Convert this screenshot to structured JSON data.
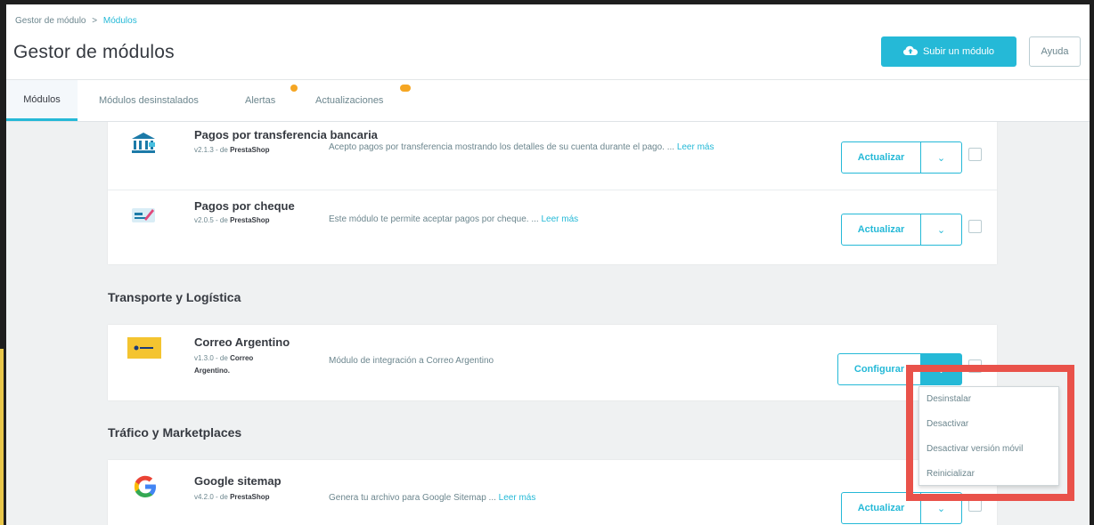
{
  "breadcrumb": {
    "parent": "Gestor de módulo",
    "separator": ">",
    "current": "Módulos"
  },
  "header": {
    "title": "Gestor de módulos",
    "upload_label": "Subir un módulo",
    "help_label": "Ayuda"
  },
  "tabs": [
    {
      "label": "Módulos",
      "active": true
    },
    {
      "label": "Módulos desinstalados"
    },
    {
      "label": "Alertas",
      "badge": true
    },
    {
      "label": "Actualizaciones",
      "badge": true
    }
  ],
  "payments": {
    "modules": [
      {
        "name": "Pagos por transferencia bancaria",
        "version": "v2.1.3",
        "by_prefix": "- de",
        "author": "PrestaShop",
        "description": "Acepto pagos por transferencia mostrando los detalles de su cuenta durante el pago. ...",
        "read_more": "Leer más",
        "action": "Actualizar",
        "icon": "bank-icon"
      },
      {
        "name": "Pagos por cheque",
        "version": "v2.0.5",
        "by_prefix": "- de",
        "author": "PrestaShop",
        "description": "Este módulo te permite aceptar pagos por cheque. ...",
        "read_more": "Leer más",
        "action": "Actualizar",
        "icon": "cheque-icon"
      }
    ]
  },
  "shipping": {
    "title": "Transporte y Logística",
    "module": {
      "name": "Correo Argentino",
      "version": "v1.3.0",
      "by_prefix": "- de",
      "author": "Correo Argentino.",
      "description": "Módulo de integración a Correo Argentino",
      "action": "Configurar",
      "icon": "correo-argentino-logo"
    }
  },
  "traffic": {
    "title": "Tráfico y Marketplaces",
    "module": {
      "name": "Google sitemap",
      "version": "v4.2.0",
      "by_prefix": "- de",
      "author": "PrestaShop",
      "description": "Genera tu archivo para Google Sitemap ...",
      "read_more": "Leer más",
      "action": "Actualizar",
      "icon": "google-icon"
    }
  },
  "dropdown": {
    "items": [
      "Desinstalar",
      "Desactivar",
      "Desactivar versión móvil",
      "Reinicializar"
    ]
  },
  "colors": {
    "accent": "#25b9d7",
    "highlight": "#e9524a",
    "badge": "#f5a623"
  }
}
